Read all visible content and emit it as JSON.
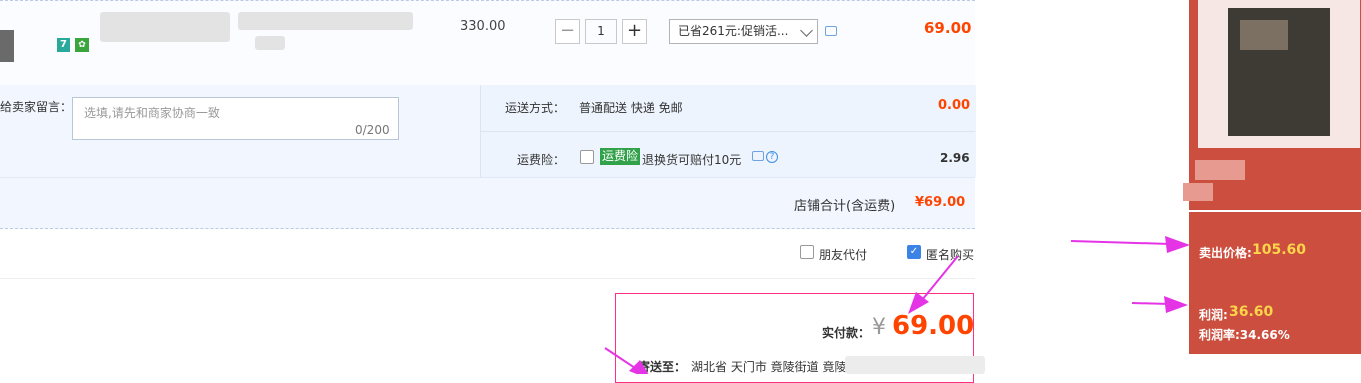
{
  "product": {
    "price": "330.00",
    "quantity": "1",
    "minus_label": "−",
    "plus_label": "+",
    "promo_label": "已省261元:促销活...",
    "subtotal": "69.00",
    "tag_a": "7"
  },
  "message": {
    "label": "给卖家留言：",
    "placeholder": "选填,请先和商家协商一致",
    "count": "0/200"
  },
  "shipping": {
    "label": "运送方式：",
    "method": "普通配送 快递 免邮",
    "fee": "0.00"
  },
  "insurance": {
    "label": "运费险：",
    "badge": "运费险",
    "desc": "退换货可赔付10元",
    "fee": "2.96"
  },
  "store_total": {
    "label": "店铺合计(含运费)",
    "value": "¥69.00"
  },
  "options": {
    "friend_pay": "朋友代付",
    "anonymous": "匿名购买",
    "anonymous_checked": true
  },
  "payment": {
    "label": "实付款：",
    "currency": "¥",
    "amount": "69.00",
    "address_label": "寄送至：",
    "address": "湖北省 天门市 竟陵街道 竟陵"
  },
  "analysis": {
    "sell_label": "卖出价格:",
    "sell_value": "105.60",
    "profit_label": "利润:",
    "profit_value": "36.60",
    "margin_text": "利润率:34.66%"
  },
  "colors": {
    "accent": "#ff4400",
    "panel": "#cc4e3e",
    "highlight": "#ffd54a",
    "arrow": "#e534e5"
  }
}
